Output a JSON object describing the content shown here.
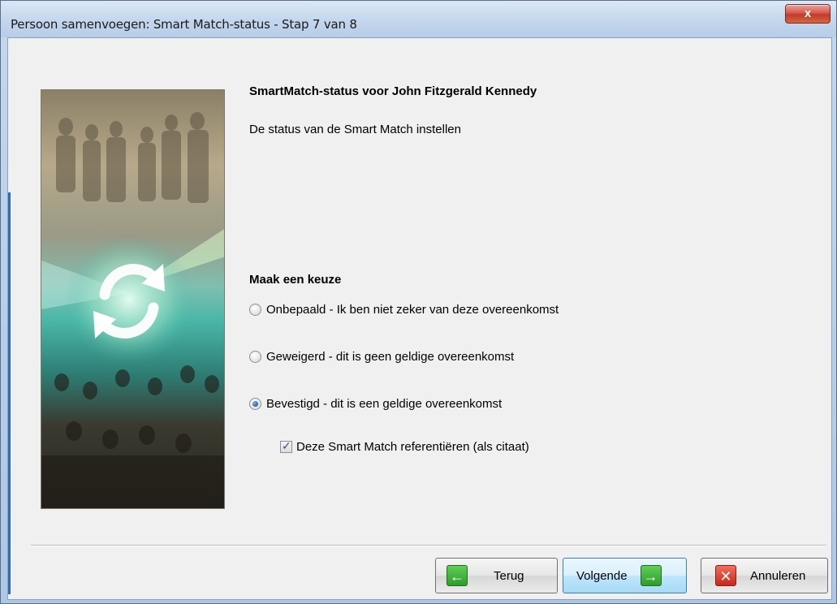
{
  "window": {
    "title": "Persoon samenvoegen: Smart Match-status - Stap 7 van 8",
    "close_glyph": "x"
  },
  "main": {
    "heading": "SmartMatch-status voor John Fitzgerald Kennedy",
    "subheading": "De status van de Smart Match instellen",
    "choice_label": "Maak een keuze",
    "options": [
      {
        "label": "Onbepaald - Ik ben niet zeker van deze overeenkomst",
        "selected": false
      },
      {
        "label": "Geweigerd - dit is geen geldige overeenkomst",
        "selected": false
      },
      {
        "label": "Bevestigd - dit is een geldige overeenkomst",
        "selected": true
      }
    ],
    "cite_checkbox": {
      "label": "Deze Smart Match referentiëren (als citaat)",
      "checked": true
    }
  },
  "footer": {
    "back_label": "Terug",
    "next_label": "Volgende",
    "cancel_label": "Annuleren",
    "back_icon": "arrow-left-icon",
    "next_icon": "arrow-right-icon",
    "cancel_icon": "close-x-icon"
  },
  "colors": {
    "accent_green": "#2e9c2a",
    "accent_red": "#c8281b",
    "default_button": "#bee6fd",
    "radio_selected": "#1d5fb0"
  }
}
